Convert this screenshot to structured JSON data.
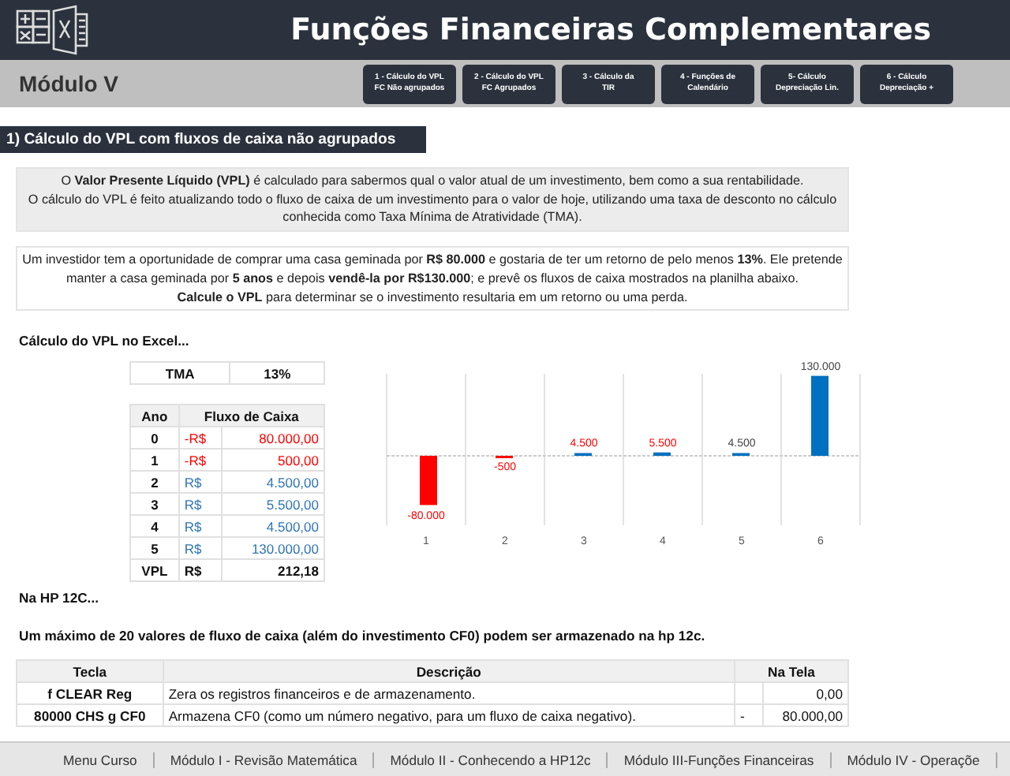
{
  "header": {
    "title": "Funções Financeiras Complementares"
  },
  "module_bar": {
    "title": "Módulo V",
    "nav_buttons": [
      {
        "line1": "1 - Cálculo do VPL",
        "line2": "FC Não agrupados"
      },
      {
        "line1": "2 - Cálculo do VPL",
        "line2": "FC Agrupados"
      },
      {
        "line1": "3 - Cálculo da",
        "line2": "TIR"
      },
      {
        "line1": "4 - Funções de",
        "line2": "Calendário"
      },
      {
        "line1": "5- Cálculo",
        "line2": "Depreciação Lin."
      },
      {
        "line1": "6 - Cálculo",
        "line2": "Depreciação +"
      }
    ]
  },
  "section_title": "1) Cálculo do VPL com fluxos de caixa não agrupados",
  "intro_lines": [
    "O **Valor Presente Líquido (VPL)** é calculado para sabermos qual o valor atual de um investimento, bem como a sua rentabilidade.",
    "O cálculo do VPL é feito atualizando todo o fluxo de caixa de um investimento para o valor de hoje, utilizando uma taxa de desconto no cálculo conhecida como Taxa Mínima de Atratividade (TMA)."
  ],
  "problem_lines": [
    "Um investidor tem a oportunidade de comprar uma casa geminada por **R$ 80.000** e gostaria de ter um retorno de pelo menos **13%**. Ele pretende manter a casa geminada por **5 anos** e depois **vendê-la por R$130.000**; e prevê os fluxos de caixa mostrados na planilha abaixo.",
    "**Calcule o VPL** para determinar se o investimento resultaria em um retorno ou uma perda."
  ],
  "excel_heading": "Cálculo do VPL no Excel...",
  "tma": {
    "label": "TMA",
    "value": "13%"
  },
  "cash_flow_table": {
    "columns": [
      "Ano",
      "Fluxo de Caixa"
    ],
    "rows": [
      {
        "year": "0",
        "currency": "-R$",
        "amount": "80.000,00",
        "kind": "negative"
      },
      {
        "year": "1",
        "currency": "-R$",
        "amount": "500,00",
        "kind": "negative"
      },
      {
        "year": "2",
        "currency": "R$",
        "amount": "4.500,00",
        "kind": "positive"
      },
      {
        "year": "3",
        "currency": "R$",
        "amount": "5.500,00",
        "kind": "positive"
      },
      {
        "year": "4",
        "currency": "R$",
        "amount": "4.500,00",
        "kind": "positive"
      },
      {
        "year": "5",
        "currency": "R$",
        "amount": "130.000,00",
        "kind": "positive"
      },
      {
        "year": "VPL",
        "currency": "R$",
        "amount": "212,18",
        "kind": "total"
      }
    ]
  },
  "chart_data": {
    "type": "bar",
    "categories": [
      "1",
      "2",
      "3",
      "4",
      "5",
      "6"
    ],
    "stacked": true,
    "ref_lines": [
      {
        "axis": "y",
        "value": 0
      }
    ],
    "series": [
      {
        "color": "#ff0000",
        "values": [
          -80000,
          -500,
          null,
          null,
          null,
          null
        ],
        "value_labels": [
          "-80.000",
          "-500",
          null,
          null,
          null,
          null
        ]
      },
      {
        "color": "#0070c0",
        "values": [
          null,
          null,
          4500,
          5500,
          4500,
          130000
        ],
        "value_labels": [
          null,
          null,
          "4.500",
          "5.500",
          "4.500",
          "130.000"
        ]
      }
    ]
  },
  "hp_heading": "Na HP 12C...",
  "hp_note": "Um máximo de 20 valores de fluxo de caixa (além do investimento CF0) podem ser armazenado na hp 12c.",
  "hp_table": {
    "columns": [
      "Tecla",
      "Descrição",
      "Na Tela"
    ],
    "rows": [
      {
        "key": "f CLEAR Reg",
        "description": "Zera os registros financeiros e de armazenamento.",
        "sign": "",
        "display": "0,00"
      },
      {
        "key": "80000 CHS g CF0",
        "description": "Armazena CF0 (como um número negativo, para um fluxo de caixa negativo).",
        "sign": "-",
        "display": "80.000,00"
      }
    ]
  },
  "sheet_tabs": [
    "Menu Curso",
    "Módulo I - Revisão Matemática",
    "Módulo II - Conhecendo a HP12c",
    "Módulo III-Funções Financeiras",
    "Módulo IV - Operaçõe"
  ]
}
